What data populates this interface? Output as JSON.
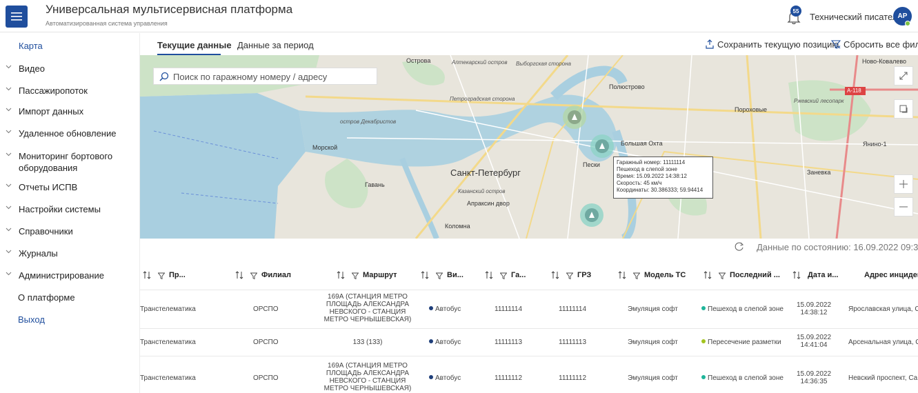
{
  "header": {
    "title": "Универсальная мультисервисная платформа",
    "subtitle": "Автоматизированная система управления",
    "notifications_count": "55",
    "user_name": "Технический писатель",
    "user_initials": "АР",
    "accent_color": "#1f4e9d"
  },
  "sidebar": {
    "items": [
      {
        "label": "Карта",
        "icon": "none"
      },
      {
        "label": "Видео",
        "icon": "chevron-down-icon"
      },
      {
        "label": "Пассажиропоток",
        "icon": "chevron-down-icon"
      },
      {
        "label": "Импорт данных",
        "icon": "chevron-down-icon"
      },
      {
        "label": "Удаленное обновление",
        "icon": "chevron-down-icon"
      },
      {
        "label": "Мониторинг бортового оборудования",
        "icon": "chevron-down-icon"
      },
      {
        "label": "Отчеты ИСПВ",
        "icon": "chevron-down-icon"
      },
      {
        "label": "Настройки системы",
        "icon": "chevron-down-icon"
      },
      {
        "label": "Справочники",
        "icon": "chevron-down-icon"
      },
      {
        "label": "Журналы",
        "icon": "chevron-down-icon"
      },
      {
        "label": "Администрирование",
        "icon": "chevron-down-icon"
      },
      {
        "label": "О платформе",
        "icon": "none"
      },
      {
        "label": "Выход",
        "icon": "none"
      }
    ]
  },
  "tabs": {
    "current": "Текущие данные",
    "period": "Данные за период",
    "save_position": "Сохранить текущую позицию",
    "reset_filters": "Сбросить все фильтры"
  },
  "map": {
    "search_placeholder": "Поиск по гаражному номеру / адресу",
    "city_label": "Санкт-Петербург",
    "labels": {
      "ostrova": "Острова",
      "aptekarsky": "Аптекарский остров",
      "vyborgskaya": "Выборгская сторона",
      "novo_kovalevo": "Ново-Ковалево",
      "polyustrovo": "Полюстрово",
      "petrogradskaya": "Петроградская сторона",
      "porokhovye": "Пороховые",
      "rzhevsky": "Ржевский лесопарк",
      "dekabristov": "остров Декабристов",
      "morskoy": "Морской",
      "bolshaya_okhta": "Большая Охта",
      "yanino": "Янино-1",
      "peski": "Пески",
      "gavan": "Гавань",
      "kazansky": "Казанский остров",
      "apraksin": "Апраксин двор",
      "kolomna": "Коломна",
      "zanevka": "Заневка",
      "road": "А-118"
    },
    "tooltip": {
      "garage": "Гаражный номер: 11111114",
      "event": "Пешеход в слепой зоне",
      "time": "Время: 15.09.2022 14:38:12",
      "speed": "Скорость: 45 км/ч",
      "coords": "Координаты: 30.386333; 59.94414"
    }
  },
  "status": {
    "text": "Данные по состоянию: 16.09.2022 09:33:16"
  },
  "table": {
    "columns": [
      "Пр...",
      "Филиал",
      "Маршрут",
      "Ви...",
      "Га...",
      "ГРЗ",
      "Модель ТС",
      "Последний ...",
      "Дата и...",
      "Адрес инцидент"
    ],
    "rows": [
      {
        "provider": "Транстелематика",
        "branch": "ОРСПО",
        "route": "169А (СТАНЦИЯ МЕТРО ПЛОЩАДЬ АЛЕКСАНДРА НЕВСКОГО - СТАНЦИЯ МЕТРО ЧЕРНЫШЕВСКАЯ)",
        "type": "Автобус",
        "type_color": "#1f3f7a",
        "garage": "11111114",
        "grz": "11111114",
        "model": "Эмуляция софт",
        "last": "Пешеход в слепой зоне",
        "last_color": "#1fb59a",
        "date": "15.09.2022",
        "time": "14:38:12",
        "address": "Ярославская улица, С"
      },
      {
        "provider": "Транстелематика",
        "branch": "ОРСПО",
        "route": "133 (133)",
        "type": "Автобус",
        "type_color": "#1f3f7a",
        "garage": "11111113",
        "grz": "11111113",
        "model": "Эмуляция софт",
        "last": "Пересечение разметки",
        "last_color": "#a3c41f",
        "date": "15.09.2022",
        "time": "14:41:04",
        "address": "Арсенальная улица, С"
      },
      {
        "provider": "Транстелематика",
        "branch": "ОРСПО",
        "route": "169А (СТАНЦИЯ МЕТРО ПЛОЩАДЬ АЛЕКСАНДРА НЕВСКОГО - СТАНЦИЯ МЕТРО ЧЕРНЫШЕВСКАЯ)",
        "type": "Автобус",
        "type_color": "#1f3f7a",
        "garage": "11111112",
        "grz": "11111112",
        "model": "Эмуляция софт",
        "last": "Пешеход в слепой зоне",
        "last_color": "#1fb59a",
        "date": "15.09.2022",
        "time": "14:36:35",
        "address": "Невский проспект, Са"
      }
    ]
  }
}
